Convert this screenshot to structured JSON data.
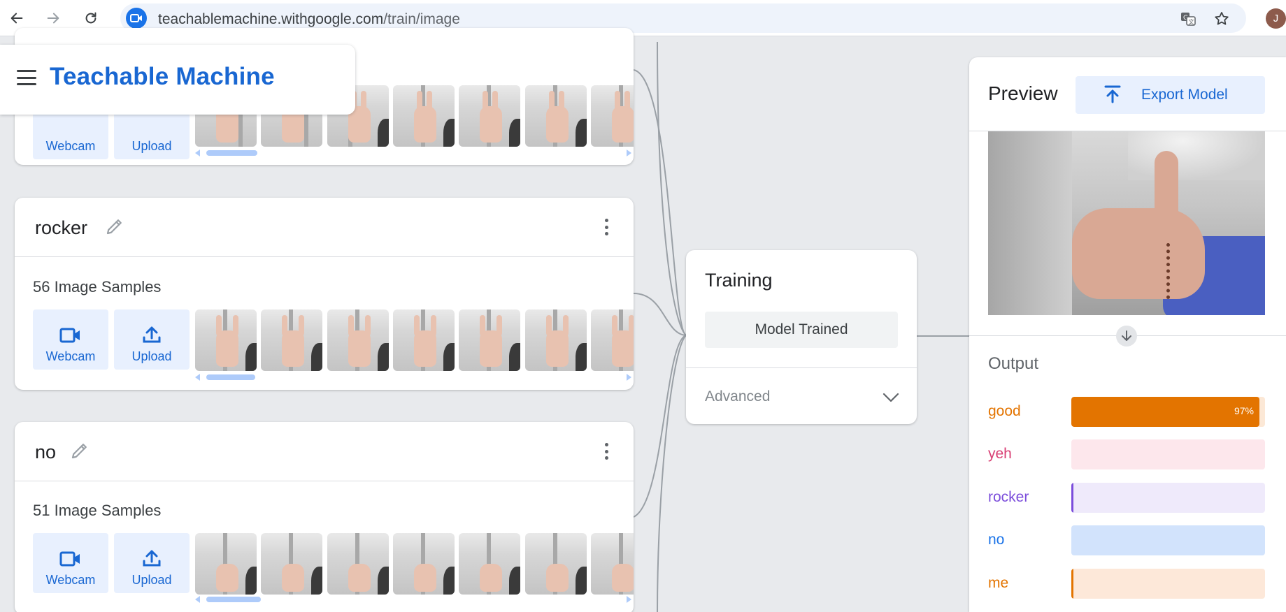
{
  "browser": {
    "url_host": "teachablemachine.withgoogle.com",
    "url_path": "/train/image",
    "profile_initial": "J"
  },
  "app": {
    "title": "Teachable Machine"
  },
  "classes": [
    {
      "name": "",
      "samples_label": "",
      "webcam_label": "Webcam",
      "upload_label": "Upload"
    },
    {
      "name": "rocker",
      "samples_label": "56 Image Samples",
      "webcam_label": "Webcam",
      "upload_label": "Upload"
    },
    {
      "name": "no",
      "samples_label": "51 Image Samples",
      "webcam_label": "Webcam",
      "upload_label": "Upload"
    }
  ],
  "training": {
    "title": "Training",
    "button_label": "Model Trained",
    "advanced_label": "Advanced"
  },
  "preview": {
    "title": "Preview",
    "export_label": "Export Model",
    "output_title": "Output",
    "outputs": [
      {
        "label": "good",
        "percent_text": "97%",
        "value": 0.97,
        "color": "#e37400",
        "track": "#fce8d6"
      },
      {
        "label": "yeh",
        "percent_text": "",
        "value": 0.0,
        "color": "#d93f74",
        "track": "#fde7ec"
      },
      {
        "label": "rocker",
        "percent_text": "",
        "value": 0.01,
        "color": "#7b4ddb",
        "track": "#efeafb"
      },
      {
        "label": "no",
        "percent_text": "",
        "value": 0.0,
        "color": "#1a73e8",
        "track": "#d2e3fc"
      },
      {
        "label": "me",
        "percent_text": "",
        "value": 0.01,
        "color": "#e37400",
        "track": "#fde8d9"
      }
    ]
  },
  "icons": {
    "back": "arrow-left-icon",
    "forward": "arrow-right-icon",
    "reload": "reload-icon",
    "translate": "translate-icon",
    "star": "star-icon",
    "menu": "hamburger-icon",
    "webcam": "video-camera-icon",
    "upload": "upload-icon",
    "edit": "pencil-icon",
    "more": "more-vert-icon",
    "export": "export-upload-icon",
    "chevron": "chevron-down-icon",
    "scroll_down": "arrow-down-circle-icon"
  }
}
